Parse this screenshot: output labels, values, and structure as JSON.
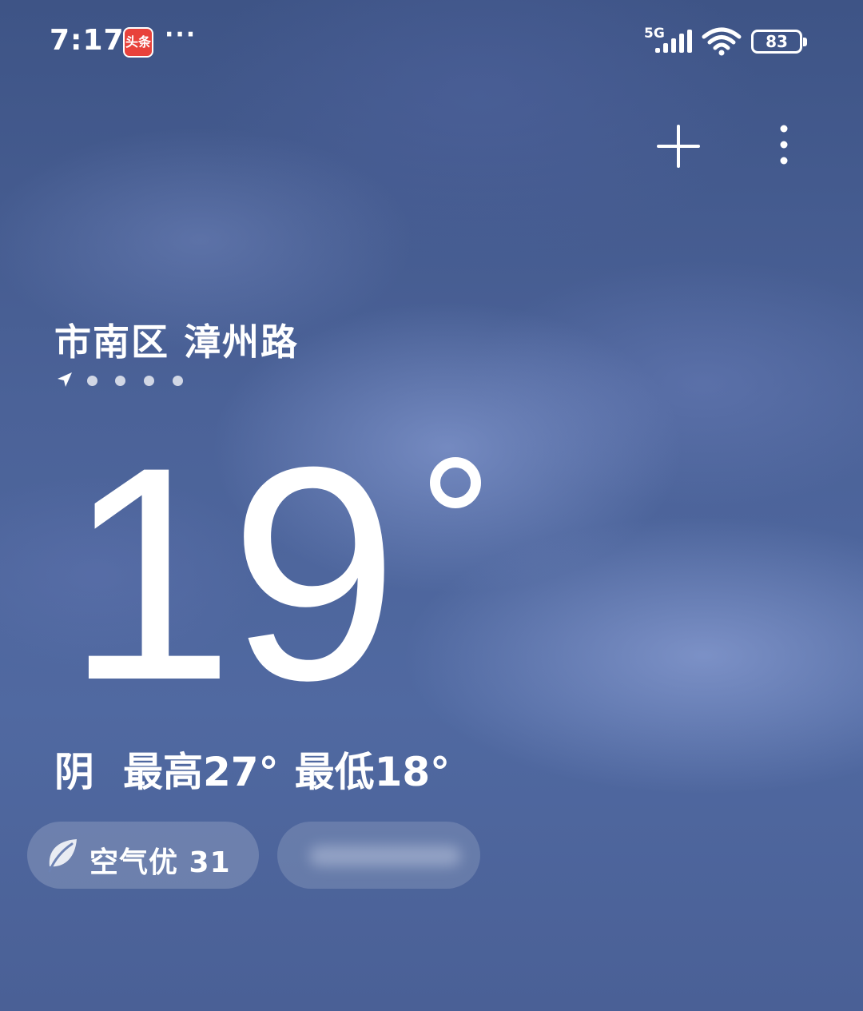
{
  "status_bar": {
    "time": "7:17",
    "news_app_label": "头条",
    "more_notifications": "···",
    "network_type": "5G",
    "battery_level": "83"
  },
  "location": {
    "name": "市南区 漳州路",
    "page_count": 5,
    "current_page": 1
  },
  "weather": {
    "current_temp": "19",
    "condition": "阴",
    "high": "最高27°",
    "low": "最低18°"
  },
  "air_quality": {
    "label": "空气优 31"
  },
  "icons": {
    "add": "plus-icon",
    "menu": "more-vertical-icon",
    "locate": "location-arrow-icon",
    "aqi": "leaf-icon"
  },
  "colors": {
    "sky": "#4b6298",
    "text": "#ffffff",
    "news_icon": "#e8423b"
  }
}
